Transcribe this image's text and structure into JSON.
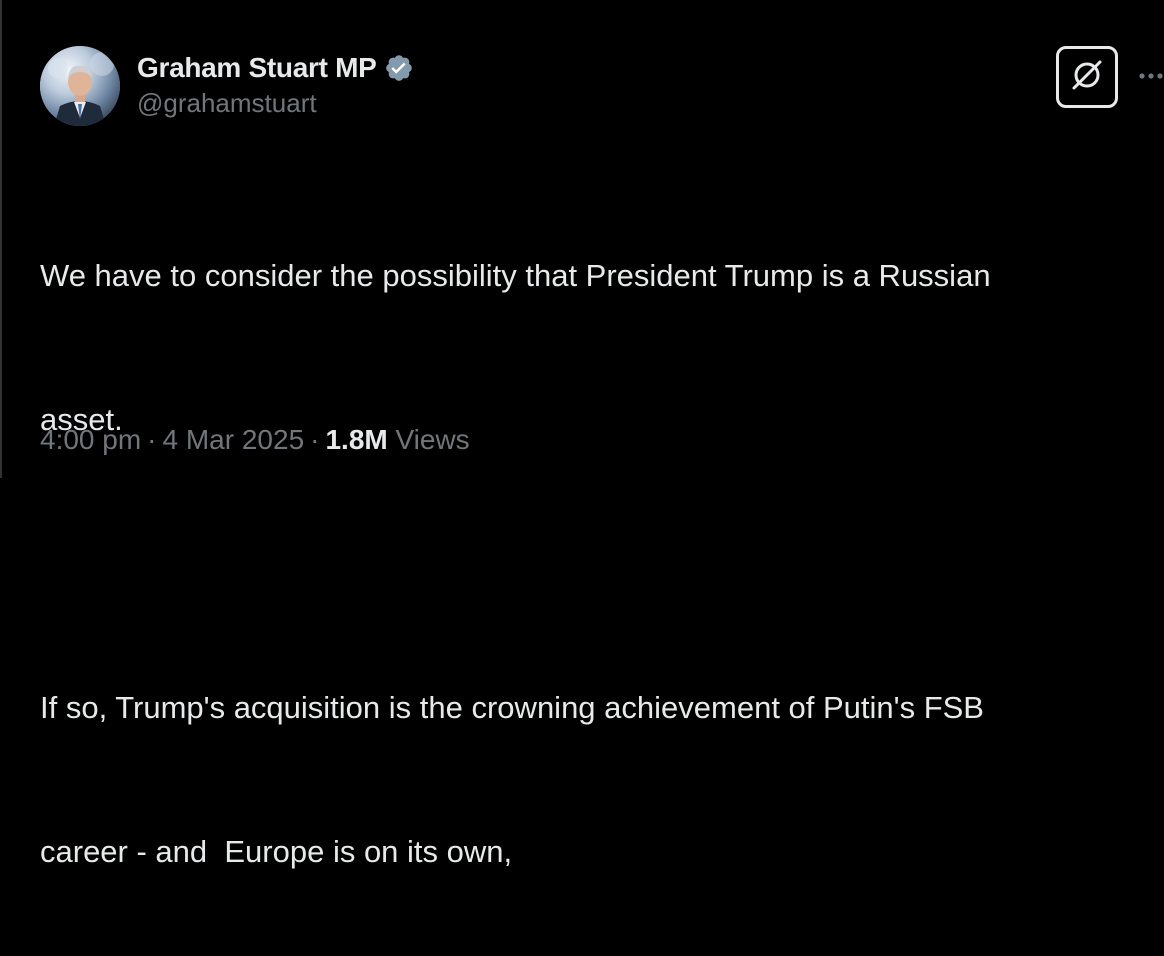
{
  "author": {
    "name": "Graham Stuart MP",
    "handle": "@grahamstuart",
    "verified": true,
    "verified_badge_color": "#829aab",
    "avatar_icon": "profile-photo"
  },
  "actions": {
    "grok_icon": "grok-icon",
    "more_icon": "more-options-icon",
    "more_label": "···"
  },
  "tweet": {
    "paragraph_1_line_1": "We have to consider the possibility that President Trump is a Russian",
    "paragraph_1_line_2": "asset.",
    "paragraph_2_line_1": "If so, Trump's acquisition is the crowning achievement of Putin's FSB",
    "paragraph_2_line_2": "career - and  Europe is on its own,"
  },
  "meta": {
    "time": "4:00 pm",
    "separator": "·",
    "date": "4 Mar 2025",
    "views_count": "1.8M",
    "views_label": "Views"
  },
  "colors": {
    "background": "#000000",
    "primary_text": "#e7e9ea",
    "secondary_text": "#71767b",
    "border": "#2f3336"
  }
}
